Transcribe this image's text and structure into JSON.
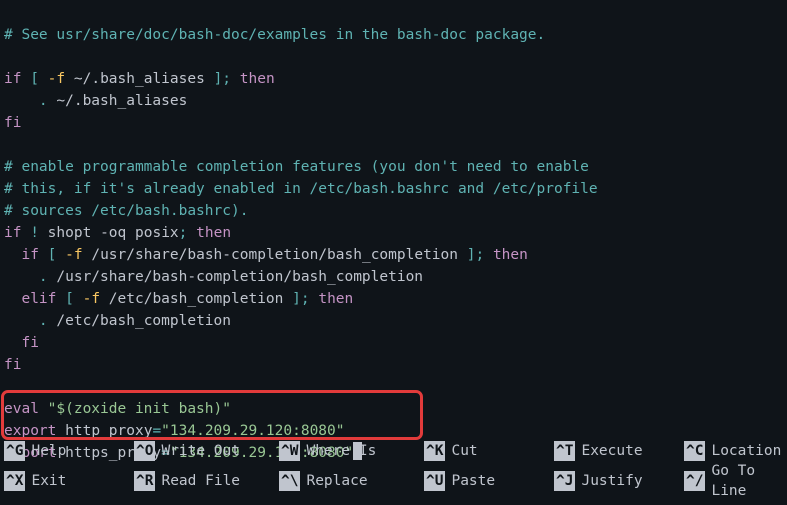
{
  "code": {
    "l1": "# See usr/share/doc/bash-doc/examples in the bash-doc package.",
    "l2_if": "if",
    "l2_lb": "[",
    "l2_fl": "-f",
    "l2_path": "~/.bash_aliases",
    "l2_rb": "];",
    "l2_then": "then",
    "l3_dot": ".",
    "l3_path": "~/.bash_aliases",
    "l4_fi": "fi",
    "c1": "# enable programmable completion features (you don't need to enable",
    "c2": "# this, if it's already enabled in /etc/bash.bashrc and /etc/profile",
    "c3": "# sources /etc/bash.bashrc).",
    "p_if": "if",
    "p_bang": "!",
    "p_shopt": "shopt",
    "p_oq": "-oq",
    "p_posix": "posix",
    "p_semi": ";",
    "p_then": "then",
    "p2_if": "if",
    "p2_lb": "[",
    "p2_fl": "-f",
    "p2_path": "/usr/share/bash-completion/bash_completion",
    "p2_rb": "];",
    "p2_then": "then",
    "p3_dot": ".",
    "p3_path": "/usr/share/bash-completion/bash_completion",
    "p4_elif": "elif",
    "p4_lb": "[",
    "p4_fl": "-f",
    "p4_path": "/etc/bash_completion",
    "p4_rb": "];",
    "p4_then": "then",
    "p5_dot": ".",
    "p5_path": "/etc/bash_completion",
    "p6_fi": "fi",
    "p7_fi": "fi",
    "ev": "eval",
    "ev_str": "\"$(zoxide init bash)\"",
    "ex1_kw": "export",
    "ex1_var": "http_proxy",
    "ex1_eq": "=",
    "ex1_val": "\"134.209.29.120:8080\"",
    "ex2_kw": "export",
    "ex2_var": "https_proxy",
    "ex2_eq": "=",
    "ex2_val": "\"134.209.29.120:8080\""
  },
  "shortcuts": {
    "g": {
      "key": "^G",
      "label": "Help"
    },
    "o": {
      "key": "^O",
      "label": "Write Out"
    },
    "w": {
      "key": "^W",
      "label": "Where Is"
    },
    "k": {
      "key": "^K",
      "label": "Cut"
    },
    "t": {
      "key": "^T",
      "label": "Execute"
    },
    "c": {
      "key": "^C",
      "label": "Location"
    },
    "x": {
      "key": "^X",
      "label": "Exit"
    },
    "r": {
      "key": "^R",
      "label": "Read File"
    },
    "bs": {
      "key": "^\\",
      "label": "Replace"
    },
    "u": {
      "key": "^U",
      "label": "Paste"
    },
    "j": {
      "key": "^J",
      "label": "Justify"
    },
    "sl": {
      "key": "^/",
      "label": "Go To Line"
    }
  }
}
